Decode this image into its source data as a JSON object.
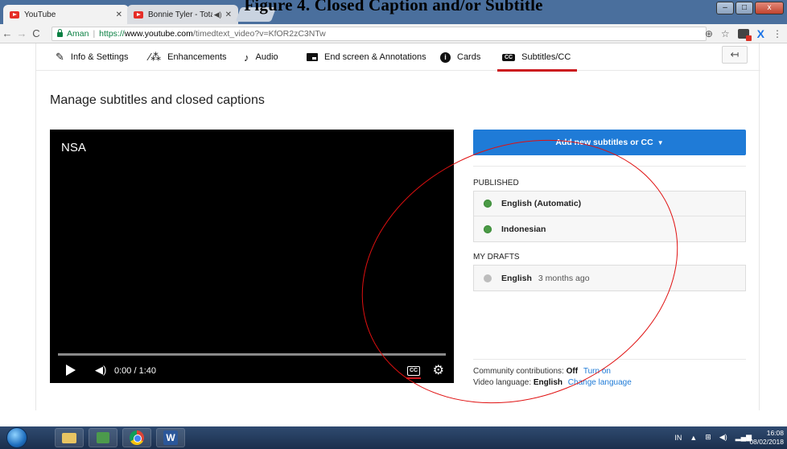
{
  "figure_caption": "Figure 4. Closed Caption and/or Subtitle",
  "browser": {
    "tabs": [
      {
        "title": "YouTube",
        "active": true
      },
      {
        "title": "Bonnie Tyler - Total E",
        "active": false
      }
    ],
    "address": {
      "secure_label": "Aman",
      "url_protocol": "https://",
      "url_host": "www.youtube.com",
      "url_path": "/timedtext_video?v=KfOR2zC3NTw"
    },
    "window_controls": {
      "minimize": "–",
      "maximize": "□",
      "close": "x"
    }
  },
  "editor": {
    "tabs": [
      {
        "label": "Info & Settings",
        "icon": "pencil-icon"
      },
      {
        "label": "Enhancements",
        "icon": "magic-wand-icon"
      },
      {
        "label": "Audio",
        "icon": "music-note-icon"
      },
      {
        "label": "End screen & Annotations",
        "icon": "end-screen-icon"
      },
      {
        "label": "Cards",
        "icon": "info-icon"
      },
      {
        "label": "Subtitles/CC",
        "icon": "cc-icon",
        "active": true
      }
    ],
    "page_title": "Manage subtitles and closed captions",
    "video": {
      "title": "NSA",
      "time": "0:00 / 1:40",
      "progress": 0
    },
    "add_button": "Add new subtitles or CC",
    "published_label": "PUBLISHED",
    "published": [
      {
        "language": "English (Automatic)",
        "status_color": "#4a9a45"
      },
      {
        "language": "Indonesian",
        "status_color": "#4a9a45"
      }
    ],
    "drafts_label": "MY DRAFTS",
    "drafts": [
      {
        "language": "English",
        "meta": "3 months ago",
        "status_color": "#bdbdbd"
      }
    ],
    "community": {
      "label": "Community contributions:",
      "value": "Off",
      "link": "Turn on"
    },
    "video_language": {
      "label": "Video language:",
      "value": "English",
      "link": "Change language"
    }
  },
  "taskbar": {
    "tray_lang": "IN",
    "time": "16:08",
    "date": "08/02/2018"
  },
  "colors": {
    "accent_blue": "#1f7bd7",
    "youtube_red": "#cc181e",
    "annotation_red": "#e01010"
  }
}
